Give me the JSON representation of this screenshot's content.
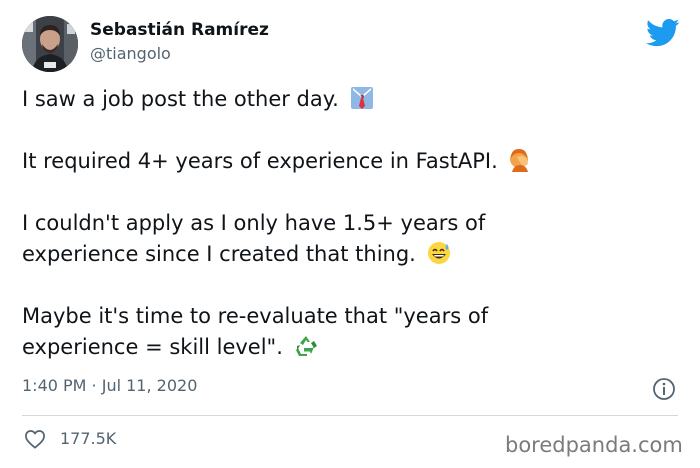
{
  "author": {
    "display_name": "Sebastián Ramírez",
    "handle": "@tiangolo",
    "avatar_icon": "profile-photo"
  },
  "tweet": {
    "paragraphs": [
      {
        "lines": [
          "I saw a job post the other day."
        ],
        "emoji": "necktie-emoji"
      },
      {
        "lines": [
          "It required 4+ years of experience in FastAPI."
        ],
        "emoji": "facepalm-emoji"
      },
      {
        "lines": [
          "I couldn't apply as I only have 1.5+ years of",
          "experience since I created that thing."
        ],
        "emoji": "sweat-smile-emoji"
      },
      {
        "lines": [
          "Maybe it's time to re-evaluate that \"years of",
          "experience = skill level\"."
        ],
        "emoji": "recycle-emoji"
      }
    ],
    "timestamp": "1:40 PM · Jul 11, 2020",
    "likes": "177.5K"
  },
  "icons": {
    "brand": "twitter-bird-icon",
    "info": "info-icon",
    "like": "heart-icon"
  },
  "colors": {
    "twitter_blue": "#1d9bf0",
    "secondary_text": "#536471"
  },
  "watermark": "boredpanda.com"
}
